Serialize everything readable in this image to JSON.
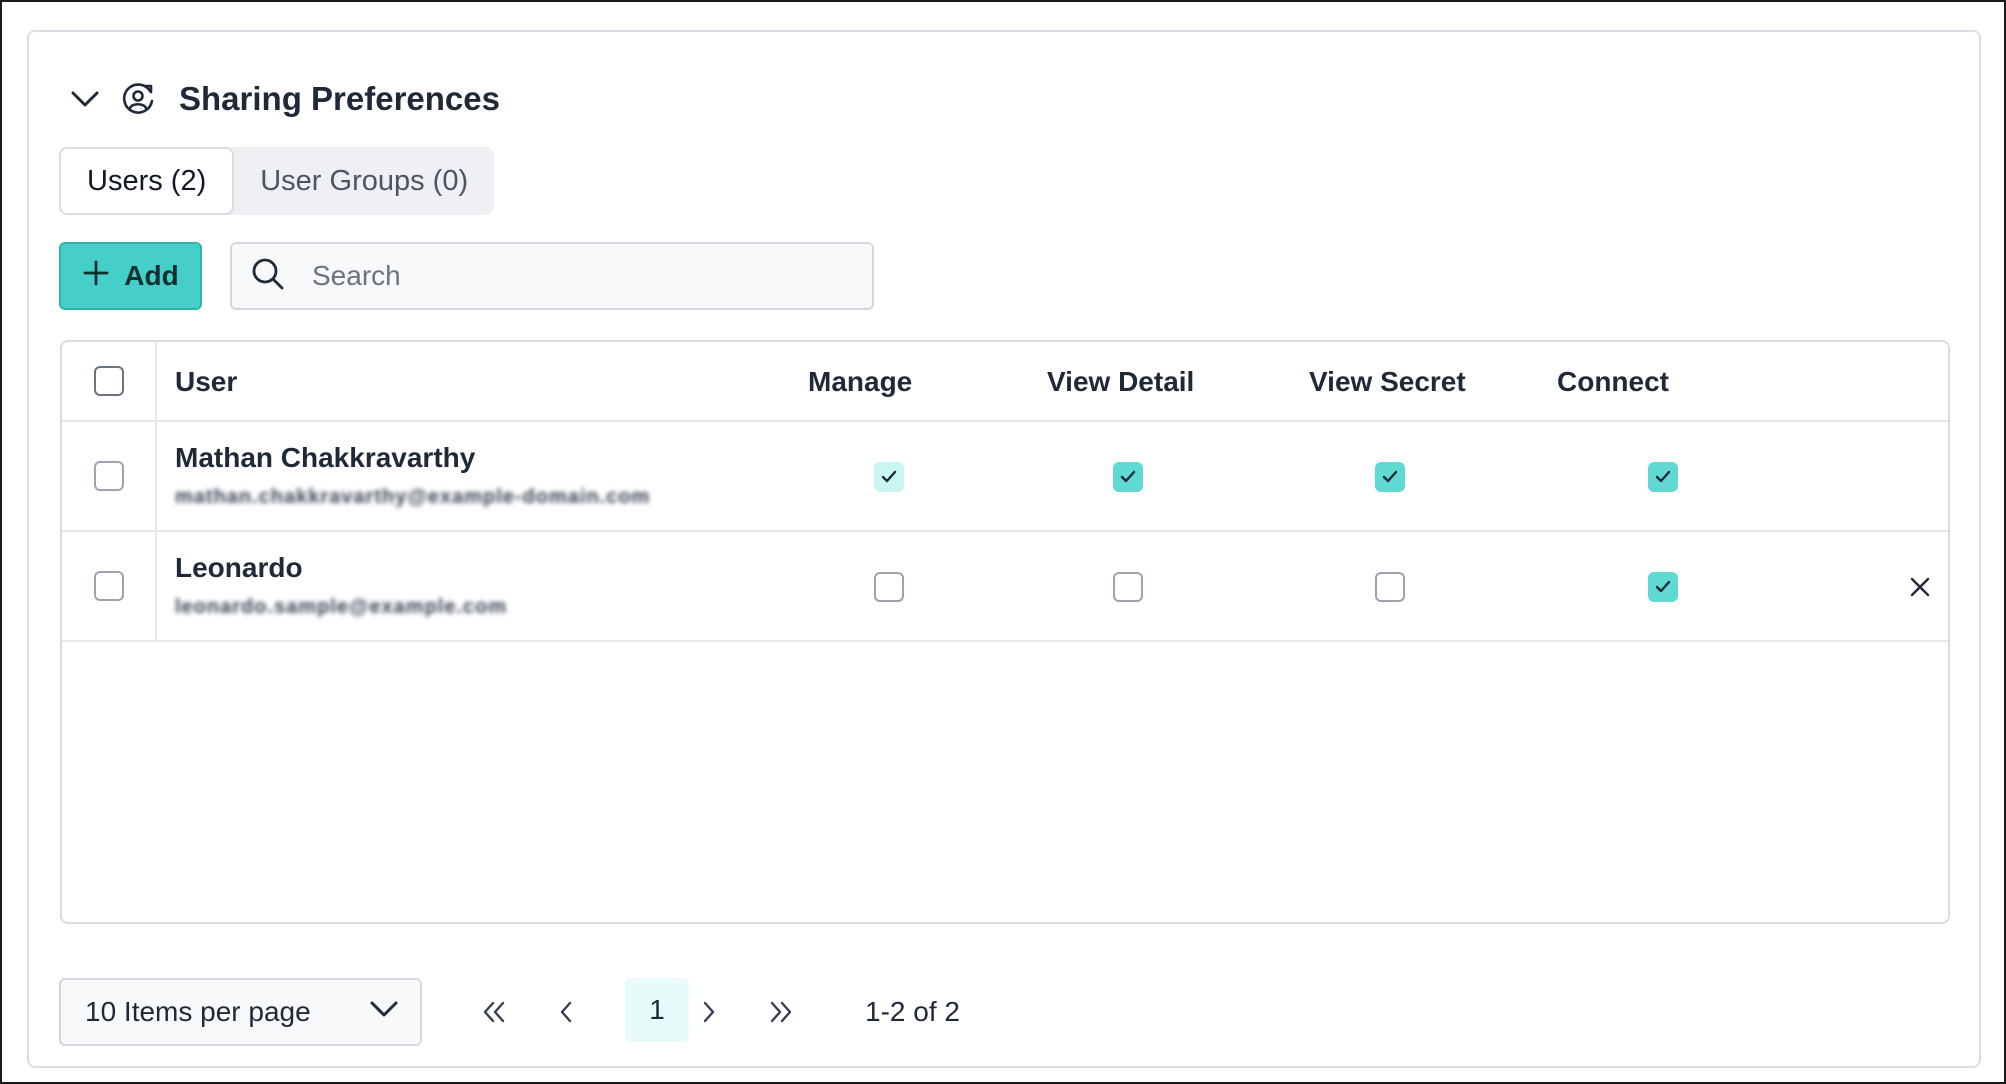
{
  "section": {
    "title": "Sharing Preferences",
    "collapse_icon": "chevron-down-icon",
    "section_icon": "user-share-icon"
  },
  "tabs": [
    {
      "label": "Users (2)",
      "active": true
    },
    {
      "label": "User Groups (0)",
      "active": false
    }
  ],
  "toolbar": {
    "add_label": "Add",
    "add_icon": "plus-icon",
    "search_placeholder": "Search",
    "search_icon": "search-icon",
    "accent_color": "#46cfc8"
  },
  "table": {
    "columns": [
      "User",
      "Manage",
      "View Detail",
      "View Secret",
      "Connect"
    ],
    "rows": [
      {
        "name": "Mathan Chakkravarthy",
        "email": "mathan.chakkravarthy@example-domain.com",
        "manage": true,
        "view_detail": true,
        "view_secret": true,
        "connect": true,
        "removable": false
      },
      {
        "name": "Leonardo",
        "email": "leonardo.sample@example.com",
        "manage": false,
        "view_detail": false,
        "view_secret": false,
        "connect": true,
        "removable": true
      }
    ]
  },
  "pagination": {
    "per_page_label": "10 Items per page",
    "current_page": "1",
    "range_label": "1-2 of 2"
  }
}
